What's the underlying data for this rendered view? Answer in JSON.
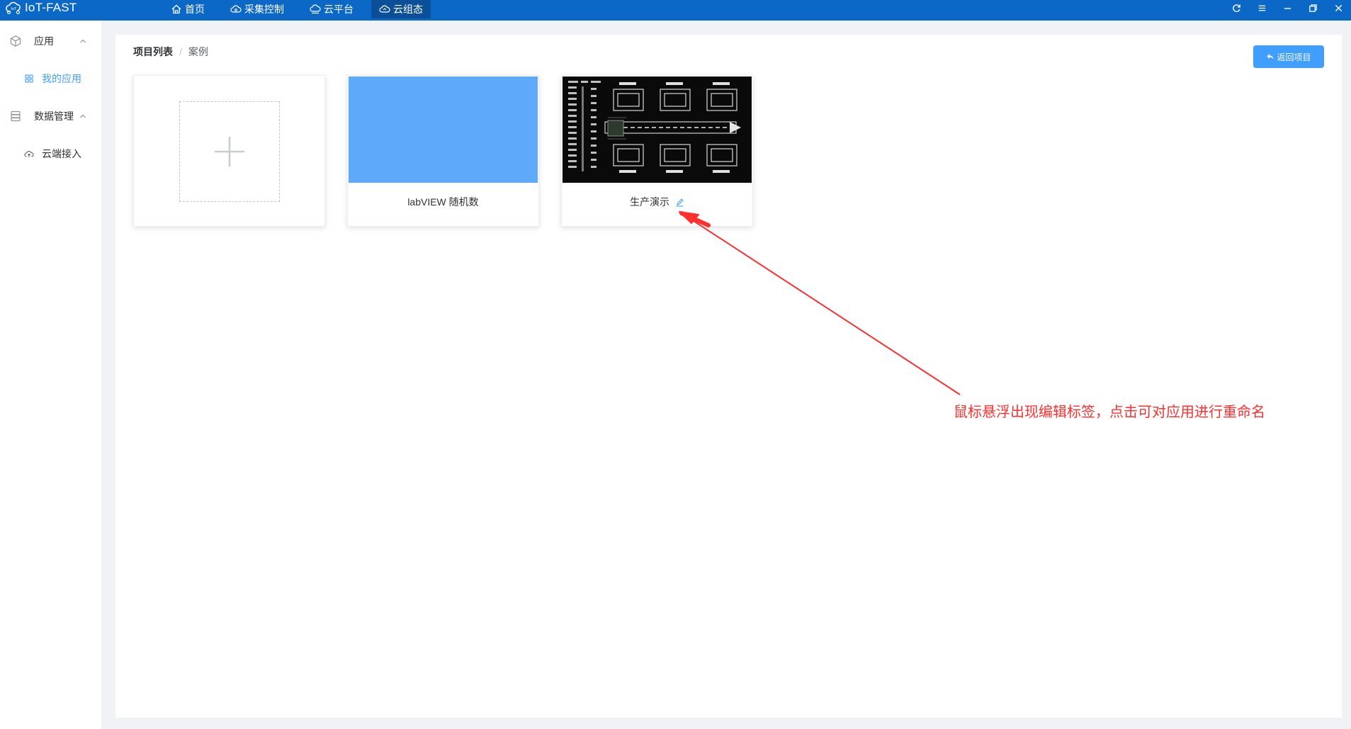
{
  "app": {
    "title": "IoT-FAST",
    "logo_icon": "iot-cloud-logo-icon"
  },
  "nav": [
    {
      "label": "首页",
      "icon": "home-icon"
    },
    {
      "label": "采集控制",
      "icon": "cloud-control-icon"
    },
    {
      "label": "云平台",
      "icon": "cloud-platform-icon"
    },
    {
      "label": "云组态",
      "icon": "cloud-config-icon",
      "active": true
    }
  ],
  "window_controls": [
    "refresh-icon",
    "menu-icon",
    "minimize-icon",
    "restore-icon",
    "close-icon"
  ],
  "sidebar": {
    "groups": [
      {
        "label": "应用",
        "icon": "cube-icon",
        "expanded": true,
        "items": [
          {
            "label": "我的应用",
            "icon": "grid-icon",
            "active": true
          }
        ]
      },
      {
        "label": "数据管理",
        "icon": "database-icon",
        "expanded": true,
        "items": [
          {
            "label": "云端接入",
            "icon": "cloud-upload-icon",
            "active": false
          }
        ]
      }
    ]
  },
  "breadcrumb": {
    "first": "项目列表",
    "separator": "/",
    "current": "案例"
  },
  "back_button": {
    "label": "返回项目",
    "icon": "return-arrow-icon"
  },
  "cards": [
    {
      "title": "labVIEW 随机数",
      "thumbnail": "solid-blue"
    },
    {
      "title": "生产演示",
      "thumbnail": "dark-scada-diagram",
      "show_edit_icon": true
    }
  ],
  "annotation": {
    "text": "鼠标悬浮出现编辑标签，点击可对应用进行重命名"
  },
  "colors": {
    "topbar": "#0b68c7",
    "nav_active": "#0a4f97",
    "accent": "#409eff",
    "card_blue": "#5fa9fb",
    "annotation_red": "#ff2f2f",
    "background": "#f0f2f5"
  }
}
